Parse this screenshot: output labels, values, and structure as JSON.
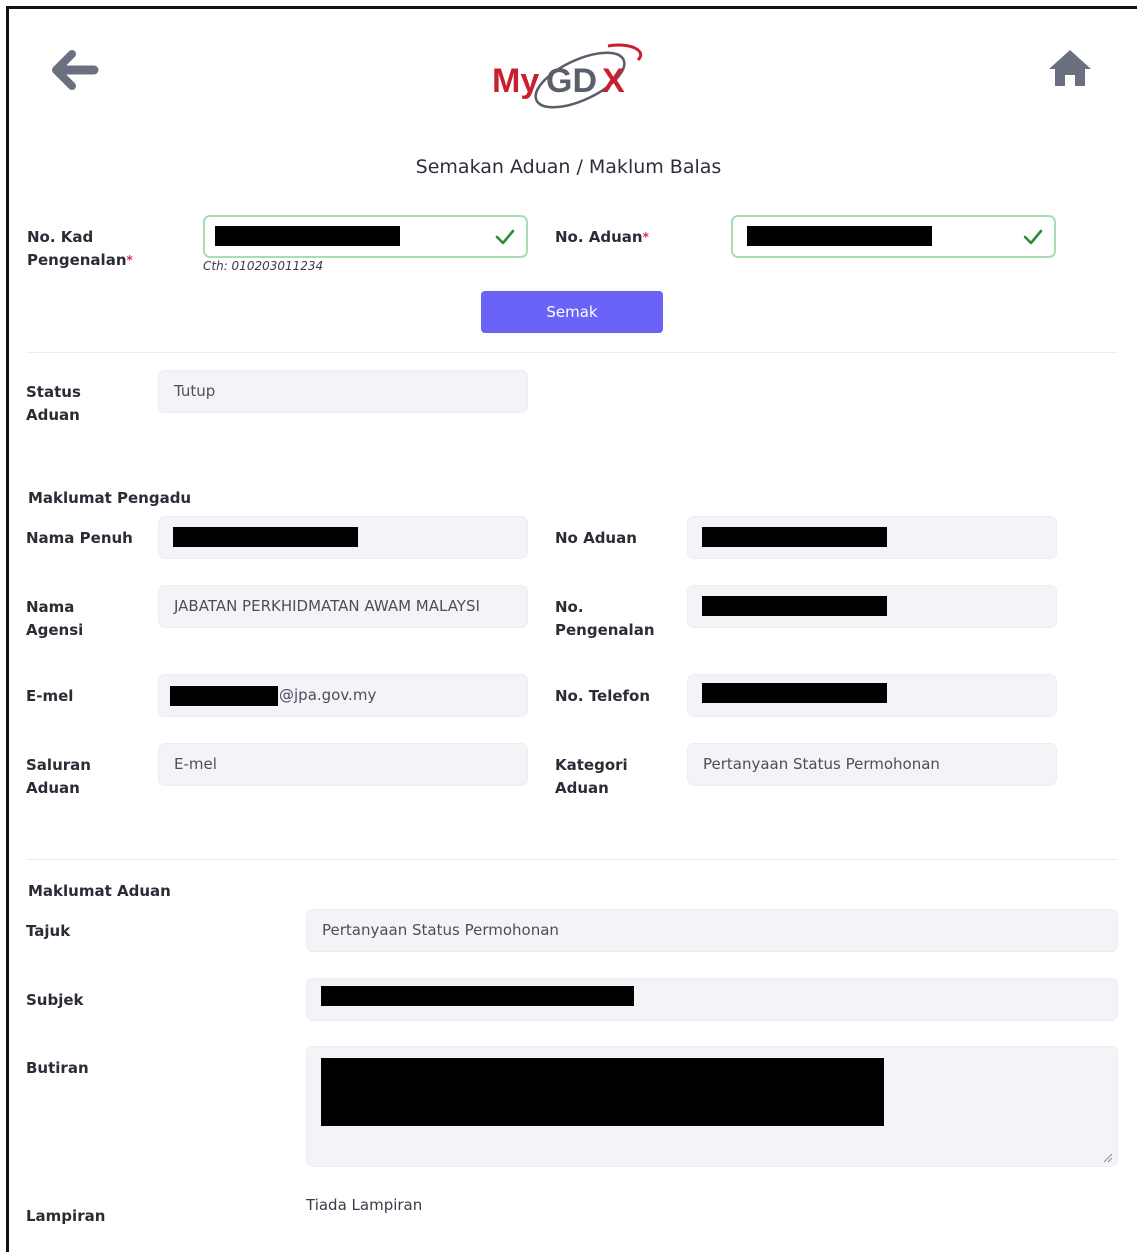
{
  "header": {
    "logo_text": "MyGDX",
    "title": "Semakan Aduan / Maklum Balas",
    "back_icon": "arrow-left-icon",
    "home_icon": "home-icon"
  },
  "search": {
    "ic_label": "No. Kad Pengenalan",
    "ic_required": "*",
    "ic_hint": "Cth: 010203011234",
    "complaint_no_label": "No. Aduan",
    "complaint_no_required": "*",
    "submit_label": "Semak"
  },
  "status": {
    "label": "Status Aduan",
    "value": "Tutup"
  },
  "complainant": {
    "heading": "Maklumat Pengadu",
    "full_name_label": "Nama Penuh",
    "complaint_no_label": "No Aduan",
    "agency_label": "Nama Agensi",
    "agency_value": "JABATAN PERKHIDMATAN AWAM MALAYSI",
    "ic_label": "No. Pengenalan",
    "email_label": "E-mel",
    "email_value_suffix": "@jpa.gov.my",
    "phone_label": "No. Telefon",
    "channel_label": "Saluran Aduan",
    "channel_value": "E-mel",
    "category_label": "Kategori Aduan",
    "category_value": "Pertanyaan Status Permohonan"
  },
  "complaint": {
    "heading": "Maklumat Aduan",
    "title_label": "Tajuk",
    "title_value": "Pertanyaan Status Permohonan",
    "subject_label": "Subjek",
    "details_label": "Butiran",
    "attachment_label": "Lampiran",
    "attachment_value": "Tiada Lampiran"
  },
  "colors": {
    "primary_button": "#6b63f7",
    "valid_border": "#a9dcb4",
    "check": "#2e8b3e",
    "logo_red": "#c8202f",
    "logo_gray": "#5a5f6b"
  }
}
